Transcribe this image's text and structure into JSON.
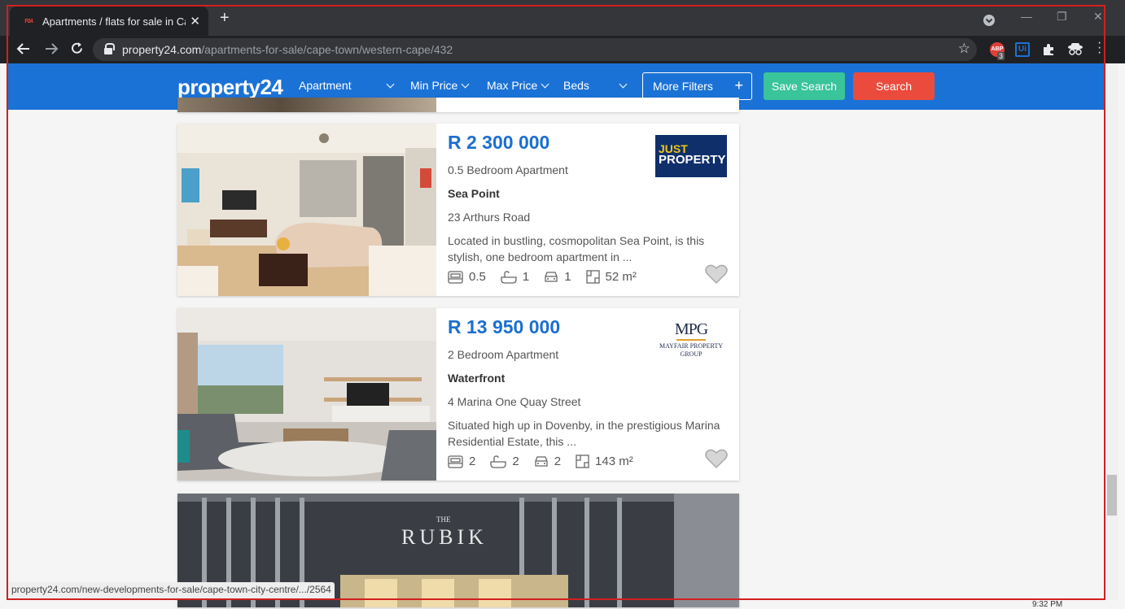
{
  "browser": {
    "tab_title": "Apartments / flats for sale in Cape",
    "favicon_text": "P24",
    "url_host": "property24.com",
    "url_path": "/apartments-for-sale/cape-town/western-cape/432",
    "ext_badge": "3",
    "status_url": "property24.com/new-developments-for-sale/cape-town-city-centre/.../2564",
    "clock": "9:32 PM"
  },
  "header": {
    "logo": "property24",
    "type_filter": "Apartment",
    "min_price": "Min Price",
    "max_price": "Max Price",
    "beds": "Beds",
    "more_filters": "More Filters",
    "save_search": "Save Search",
    "search": "Search"
  },
  "listings": [
    {
      "price": "R 2 300 000",
      "type": "0.5 Bedroom Apartment",
      "suburb": "Sea Point",
      "street": "23 Arthurs Road",
      "description": "Located in bustling, cosmopolitan Sea Point, is this stylish, one bedroom apartment in ...",
      "beds": "0.5",
      "baths": "1",
      "parking": "1",
      "size": "52 m²",
      "agency_line1": "JUST",
      "agency_line2": "PROPERTY"
    },
    {
      "price": "R 13 950 000",
      "type": "2 Bedroom Apartment",
      "suburb": "Waterfront",
      "street": "4 Marina One Quay Street",
      "description": "Situated high up in Dovenby, in the prestigious Marina Residential Estate, this ...",
      "beds": "2",
      "baths": "2",
      "parking": "2",
      "size": "143 m²",
      "agency_mark": "MPG",
      "agency_line1": "MAYFAIR PROPERTY",
      "agency_line2": "GROUP"
    }
  ],
  "development": {
    "brand": "RUBIK",
    "brand_small": "THE"
  },
  "colors": {
    "header_blue": "#1b72d6",
    "price_blue": "#1b6fd0",
    "save_green": "#39c49a",
    "search_red": "#eb4b3c"
  }
}
